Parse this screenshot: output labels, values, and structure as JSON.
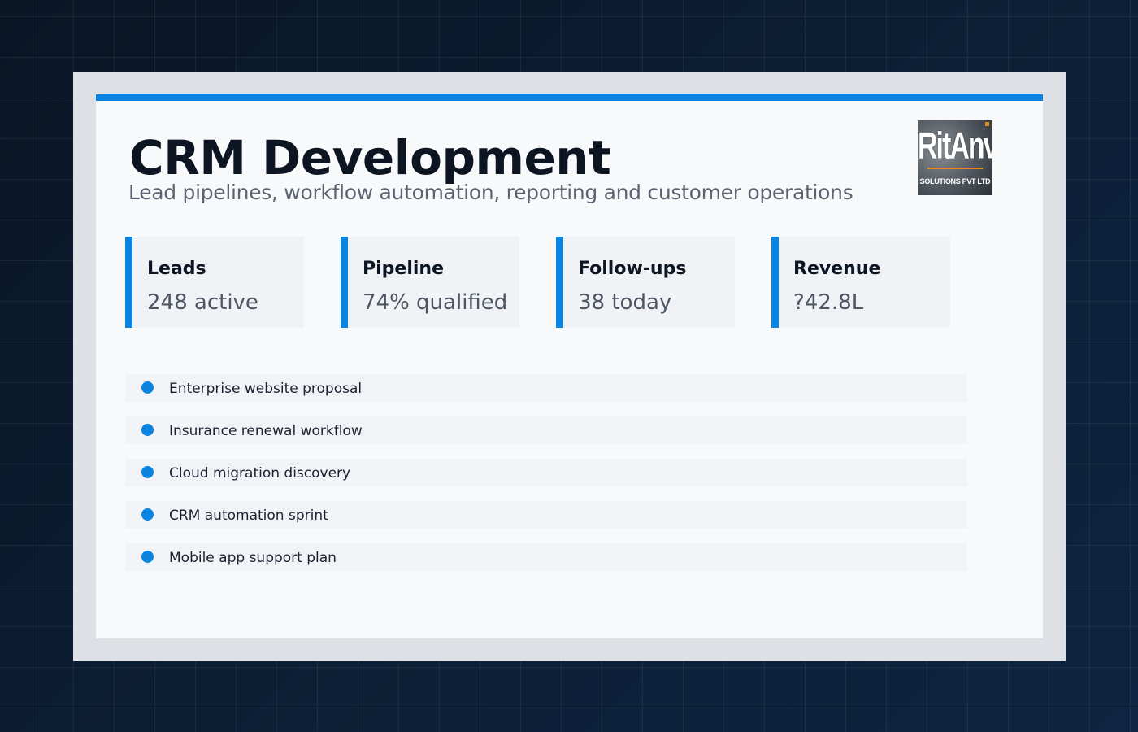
{
  "slide": {
    "title": "CRM Development",
    "subtitle": "Lead pipelines, workflow automation, reporting and customer operations"
  },
  "logo": {
    "mark": "RitAnvi",
    "tagline": "SOLUTIONS PVT LTD"
  },
  "metrics": [
    {
      "label": "Leads",
      "value": "248 active"
    },
    {
      "label": "Pipeline",
      "value": "74% qualified"
    },
    {
      "label": "Follow-ups",
      "value": "38 today"
    },
    {
      "label": "Revenue",
      "value": "?42.8L"
    }
  ],
  "items": [
    "Enterprise website proposal",
    "Insurance renewal workflow",
    "Cloud migration discovery",
    "CRM automation sprint",
    "Mobile app support plan"
  ],
  "colors": {
    "accent": "#0a84e0",
    "background": "#0b1a2c",
    "card": "#f8f9fb",
    "frame": "#dde1e6"
  }
}
